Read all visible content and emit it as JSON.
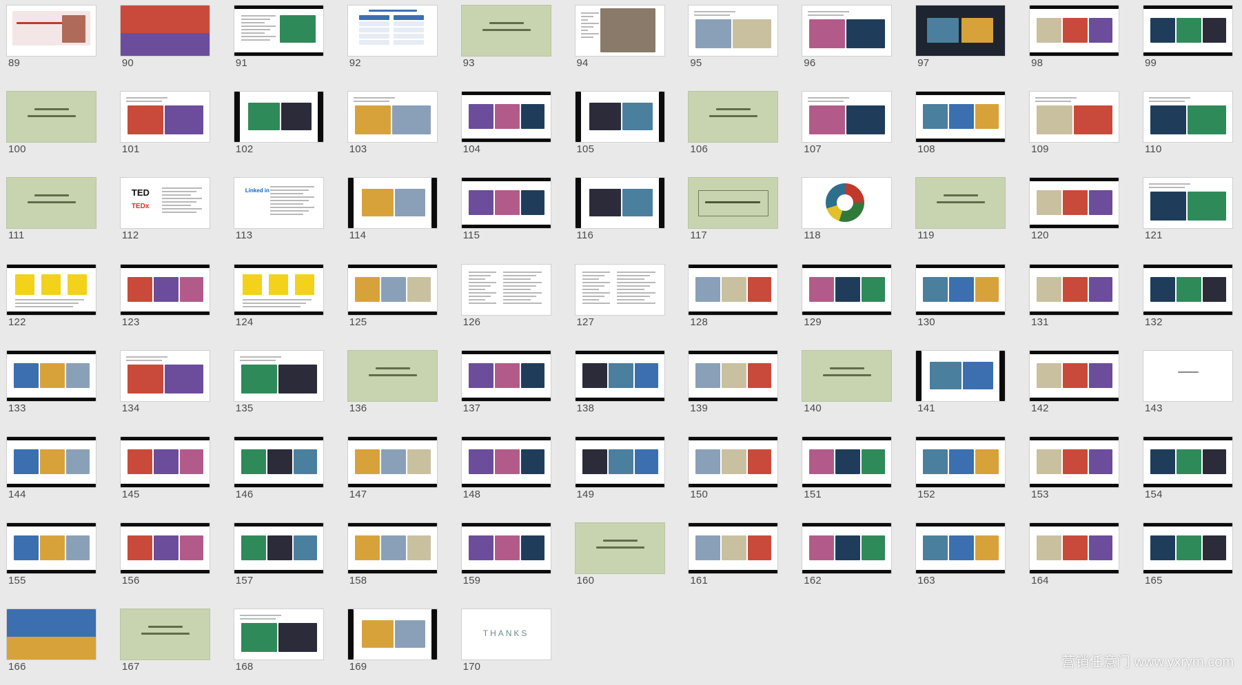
{
  "slides": [
    {
      "n": "89",
      "style": "photo-banner"
    },
    {
      "n": "90",
      "style": "photo-full"
    },
    {
      "n": "91",
      "style": "bars-text"
    },
    {
      "n": "92",
      "style": "table"
    },
    {
      "n": "93",
      "style": "green"
    },
    {
      "n": "94",
      "style": "portrait"
    },
    {
      "n": "95",
      "style": "photos"
    },
    {
      "n": "96",
      "style": "photos"
    },
    {
      "n": "97",
      "style": "photos-dark"
    },
    {
      "n": "98",
      "style": "bars-photos"
    },
    {
      "n": "99",
      "style": "bars-photos"
    },
    {
      "n": "100",
      "style": "green"
    },
    {
      "n": "101",
      "style": "photos"
    },
    {
      "n": "102",
      "style": "side-bars"
    },
    {
      "n": "103",
      "style": "photos"
    },
    {
      "n": "104",
      "style": "bars-photos"
    },
    {
      "n": "105",
      "style": "side-bars"
    },
    {
      "n": "106",
      "style": "green"
    },
    {
      "n": "107",
      "style": "photos"
    },
    {
      "n": "108",
      "style": "bars-photos"
    },
    {
      "n": "109",
      "style": "photos"
    },
    {
      "n": "110",
      "style": "photos"
    },
    {
      "n": "111",
      "style": "green"
    },
    {
      "n": "112",
      "style": "ted"
    },
    {
      "n": "113",
      "style": "linkedin"
    },
    {
      "n": "114",
      "style": "side-bars"
    },
    {
      "n": "115",
      "style": "bars-photos"
    },
    {
      "n": "116",
      "style": "side-bars"
    },
    {
      "n": "117",
      "style": "green-frame"
    },
    {
      "n": "118",
      "style": "pie"
    },
    {
      "n": "119",
      "style": "green"
    },
    {
      "n": "120",
      "style": "bars-photos"
    },
    {
      "n": "121",
      "style": "photos"
    },
    {
      "n": "122",
      "style": "bars-yellow"
    },
    {
      "n": "123",
      "style": "bars-photos"
    },
    {
      "n": "124",
      "style": "bars-yellow"
    },
    {
      "n": "125",
      "style": "bars-photos"
    },
    {
      "n": "126",
      "style": "text"
    },
    {
      "n": "127",
      "style": "text"
    },
    {
      "n": "128",
      "style": "bars-photos"
    },
    {
      "n": "129",
      "style": "bars-photos"
    },
    {
      "n": "130",
      "style": "bars-photos"
    },
    {
      "n": "131",
      "style": "bars-photos"
    },
    {
      "n": "132",
      "style": "bars-photos"
    },
    {
      "n": "133",
      "style": "bars-photos"
    },
    {
      "n": "134",
      "style": "photos"
    },
    {
      "n": "135",
      "style": "photos"
    },
    {
      "n": "136",
      "style": "green"
    },
    {
      "n": "137",
      "style": "bars-photos"
    },
    {
      "n": "138",
      "style": "bars-photos"
    },
    {
      "n": "139",
      "style": "bars-photos"
    },
    {
      "n": "140",
      "style": "green"
    },
    {
      "n": "141",
      "style": "side-bars"
    },
    {
      "n": "142",
      "style": "bars-photos"
    },
    {
      "n": "143",
      "style": "white"
    },
    {
      "n": "144",
      "style": "bars-photos"
    },
    {
      "n": "145",
      "style": "bars-photos"
    },
    {
      "n": "146",
      "style": "bars-photos"
    },
    {
      "n": "147",
      "style": "bars-photos"
    },
    {
      "n": "148",
      "style": "bars-photos"
    },
    {
      "n": "149",
      "style": "bars-photos"
    },
    {
      "n": "150",
      "style": "bars-photos"
    },
    {
      "n": "151",
      "style": "bars-photos"
    },
    {
      "n": "152",
      "style": "bars-photos"
    },
    {
      "n": "153",
      "style": "bars-photos"
    },
    {
      "n": "154",
      "style": "bars-photos"
    },
    {
      "n": "155",
      "style": "bars-photos"
    },
    {
      "n": "156",
      "style": "bars-photos"
    },
    {
      "n": "157",
      "style": "bars-photos"
    },
    {
      "n": "158",
      "style": "bars-photos"
    },
    {
      "n": "159",
      "style": "bars-photos"
    },
    {
      "n": "160",
      "style": "green"
    },
    {
      "n": "161",
      "style": "bars-photos"
    },
    {
      "n": "162",
      "style": "bars-photos"
    },
    {
      "n": "163",
      "style": "bars-photos"
    },
    {
      "n": "164",
      "style": "bars-photos"
    },
    {
      "n": "165",
      "style": "bars-photos"
    },
    {
      "n": "166",
      "style": "photo-full"
    },
    {
      "n": "167",
      "style": "green"
    },
    {
      "n": "168",
      "style": "photos"
    },
    {
      "n": "169",
      "style": "side-bars"
    },
    {
      "n": "170",
      "style": "thanks"
    }
  ],
  "thanks_text": "THANKS",
  "ted_text": "TED",
  "tedx_text": "TEDx",
  "linkedin_text": "Linked in",
  "watermark": "营销任意门 www.yxrym.com",
  "colors": {
    "background": "#e9e9e9",
    "green_slide": "#c8d3b0",
    "bar": "#0b0b0b",
    "accent_yellow": "#f2d21b",
    "label": "#4a4a4a"
  }
}
